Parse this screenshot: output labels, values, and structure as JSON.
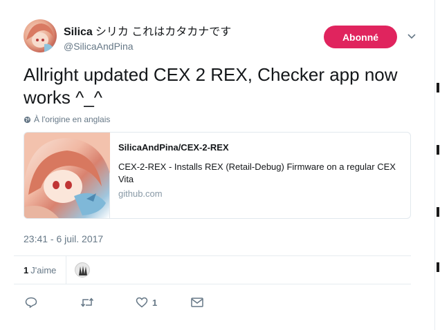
{
  "tweet": {
    "author_name": "Silica",
    "author_name_jp": "シリカ これはカタカナです",
    "handle": "@SilicaAndPina",
    "follow_label": "Abonné",
    "text": "Allright updated CEX 2 REX, Checker app now works ^_^",
    "translation_note": "À l'origine en anglais",
    "timestamp": "23:41 - 6 juil. 2017",
    "colors": {
      "follow_bg": "#e0245e",
      "muted": "#657786",
      "text": "#14171a"
    }
  },
  "card": {
    "title": "SilicaAndPina/CEX-2-REX",
    "description": "CEX-2-REX - Installs REX (Retail-Debug) Firmware on a regular CEX Vita",
    "domain": "github.com"
  },
  "stats": {
    "likes_count": "1",
    "likes_label": "J'aime"
  },
  "actions": {
    "reply_icon": "reply-icon",
    "retweet_icon": "retweet-icon",
    "like_icon": "heart-icon",
    "like_count": "1",
    "dm_icon": "envelope-icon"
  }
}
